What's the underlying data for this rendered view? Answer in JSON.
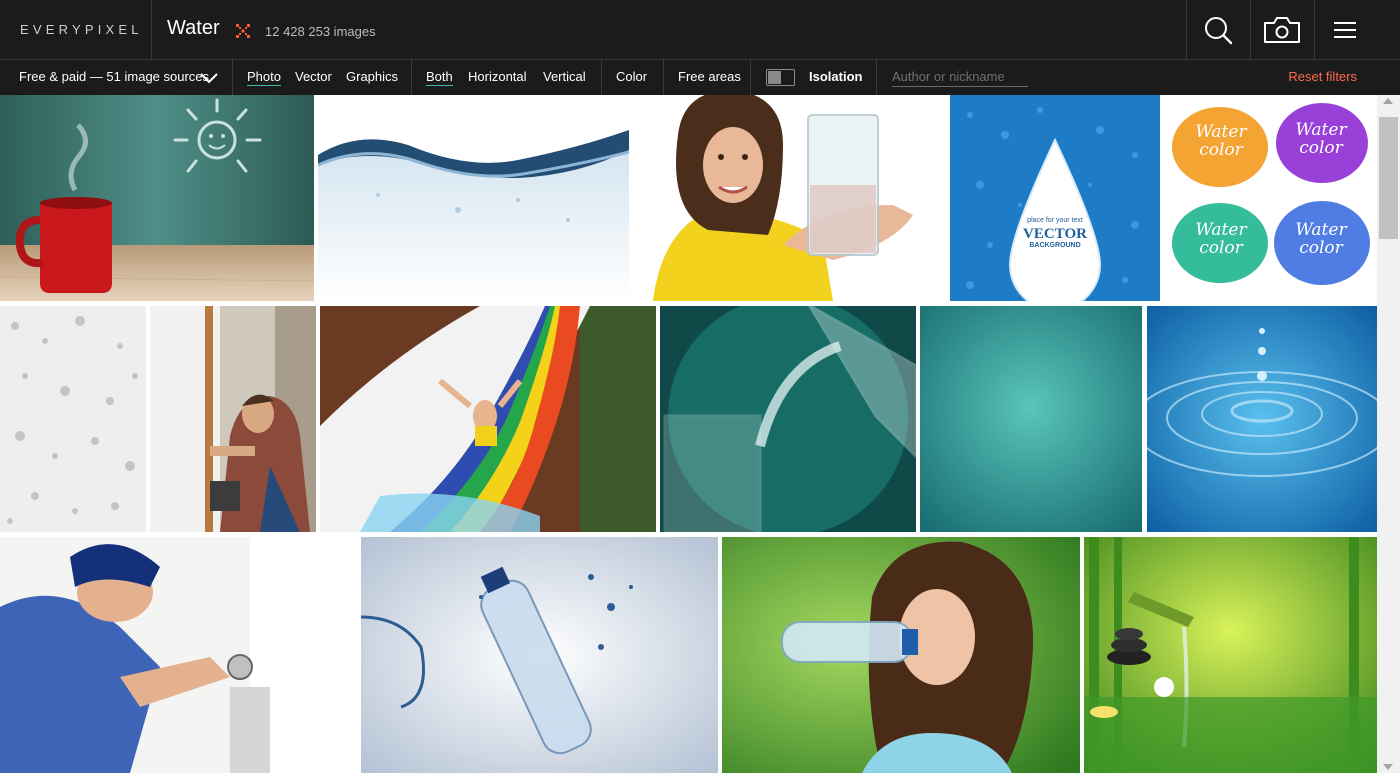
{
  "header": {
    "logo": "EVERYPIXEL",
    "query": "Water",
    "count": "12 428 253 images"
  },
  "filters": {
    "sources": "Free & paid — 51 image sources",
    "type": [
      {
        "label": "Photo",
        "active": true
      },
      {
        "label": "Vector",
        "active": false
      },
      {
        "label": "Graphics",
        "active": false
      }
    ],
    "orientation": [
      {
        "label": "Both",
        "active": true
      },
      {
        "label": "Horizontal",
        "active": false
      },
      {
        "label": "Vertical",
        "active": false
      }
    ],
    "color": "Color",
    "free_areas": "Free areas",
    "isolation": "Isolation",
    "author_placeholder": "Author or nickname",
    "reset": "Reset filters"
  },
  "tiles": {
    "vector_small": "place for your text",
    "vector_big": "VECTOR",
    "vector_sub": "BACKGROUND",
    "watercolor_1": "Water",
    "watercolor_2": "color"
  },
  "colors": {
    "header_bg": "#1b1b1b",
    "accent": "#3fb8af",
    "reset": "#ff6a4c",
    "logo_mark": "#ff5a36"
  }
}
